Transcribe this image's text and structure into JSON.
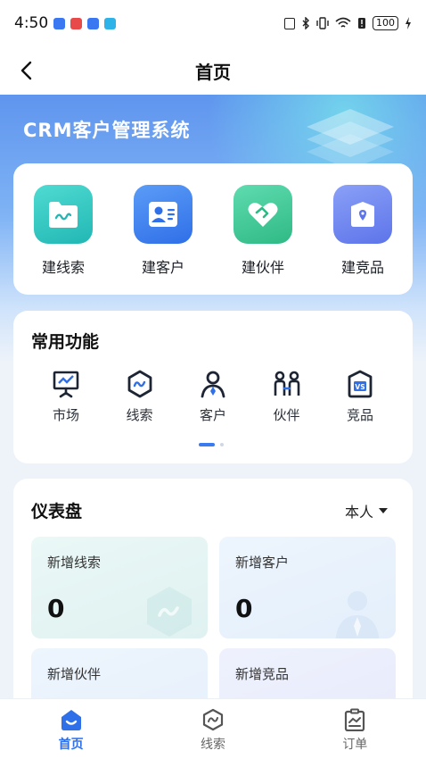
{
  "status_bar": {
    "time": "4:50",
    "battery": "100",
    "notif_colors": [
      "#3a78f2",
      "#e84a4a",
      "#3a78f2",
      "#2db3e8"
    ]
  },
  "nav": {
    "title": "首页",
    "back_icon": "chevron-left-icon"
  },
  "hero": {
    "title": "CRM客户管理系统"
  },
  "quick_actions": [
    {
      "label": "建线索",
      "icon": "folder-wave-icon",
      "color": "#2ec7c0"
    },
    {
      "label": "建客户",
      "icon": "contact-card-icon",
      "color": "#3f86f2"
    },
    {
      "label": "建伙伴",
      "icon": "heart-handshake-icon",
      "color": "#3ec89a"
    },
    {
      "label": "建竞品",
      "icon": "box-pin-icon",
      "color": "#6f86f0"
    }
  ],
  "common_functions": {
    "title": "常用功能",
    "items": [
      {
        "label": "市场",
        "icon": "presentation-icon"
      },
      {
        "label": "线索",
        "icon": "hexagon-wave-icon"
      },
      {
        "label": "客户",
        "icon": "person-tie-icon"
      },
      {
        "label": "伙伴",
        "icon": "partners-icon"
      },
      {
        "label": "竞品",
        "icon": "vs-icon"
      }
    ],
    "pager": {
      "current": 1,
      "total": 2
    }
  },
  "dashboard": {
    "title": "仪表盘",
    "filter": "本人",
    "tiles": [
      {
        "label": "新增线索",
        "value": "0"
      },
      {
        "label": "新增客户",
        "value": "0"
      },
      {
        "label": "新增伙伴",
        "value": ""
      },
      {
        "label": "新增竞品",
        "value": ""
      }
    ]
  },
  "tab_bar": {
    "tabs": [
      {
        "label": "首页",
        "icon": "home-icon",
        "active": true
      },
      {
        "label": "线索",
        "icon": "hexagon-wave-icon",
        "active": false
      },
      {
        "label": "订单",
        "icon": "clipboard-chart-icon",
        "active": false
      }
    ],
    "active_color": "#2f6fe8"
  }
}
